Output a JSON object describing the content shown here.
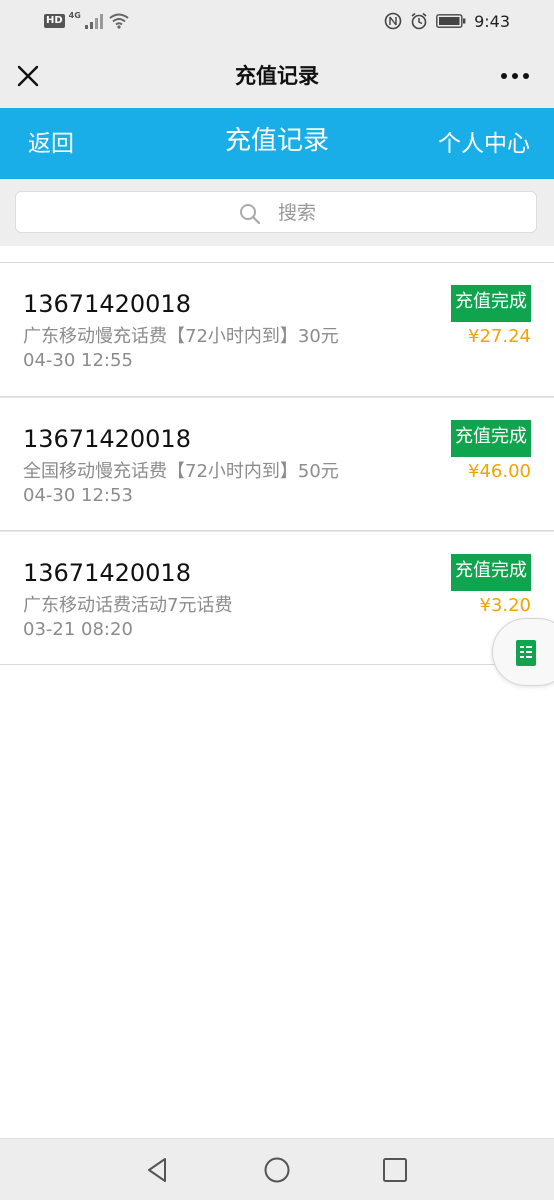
{
  "status_bar": {
    "network_badge": "HD",
    "network_type": "4G",
    "time": "9:43",
    "icons": [
      "signal-icon",
      "wifi-icon",
      "nfc-icon",
      "alarm-icon",
      "battery-icon"
    ]
  },
  "wechat_bar": {
    "title": "充值记录",
    "close_icon": "close-icon",
    "more_icon": "more-icon"
  },
  "header": {
    "back_label": "返回",
    "title": "充值记录",
    "user_center_label": "个人中心",
    "background_color": "#1aaee9"
  },
  "search": {
    "placeholder": "搜索",
    "icon": "search-icon"
  },
  "records": [
    {
      "phone": "13671420018",
      "description": "广东移动慢充话费【72小时内到】30元",
      "time": "04-30 12:55",
      "status": "充值完成",
      "amount": "¥27.24"
    },
    {
      "phone": "13671420018",
      "description": "全国移动慢充话费【72小时内到】50元",
      "time": "04-30 12:53",
      "status": "充值完成",
      "amount": "¥46.00"
    },
    {
      "phone": "13671420018",
      "description": "广东移动话费活动7元话费",
      "time": "03-21 08:20",
      "status": "充值完成",
      "amount": "¥3.20"
    }
  ],
  "colors": {
    "status_badge": "#10a44f",
    "amount": "#f0a400",
    "header": "#1aaee9"
  },
  "floating_button": {
    "icon": "document-icon"
  },
  "nav_bar": {
    "icons": [
      "nav-back-icon",
      "nav-home-icon",
      "nav-recent-icon"
    ]
  }
}
